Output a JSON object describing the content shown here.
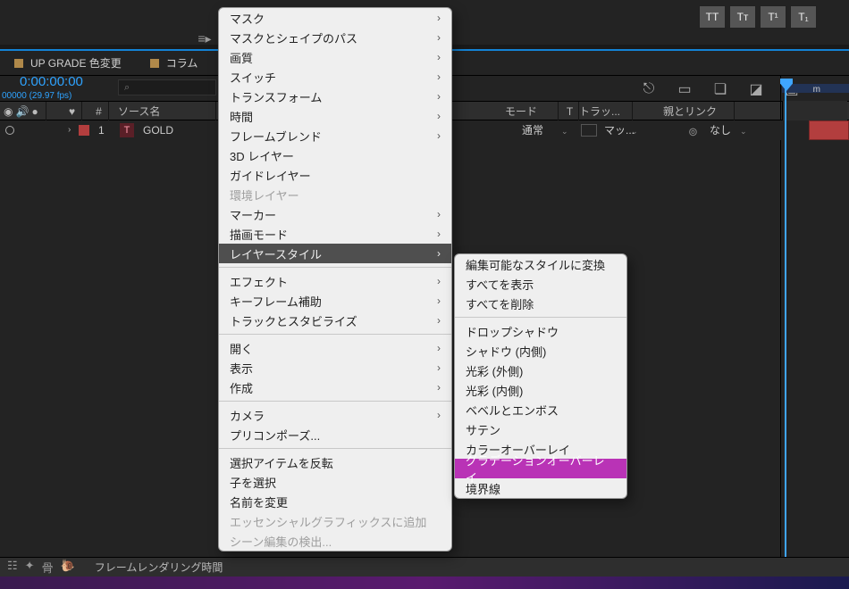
{
  "toolbar": {
    "text_styles": [
      "TT",
      "Tт",
      "T¹",
      "T₁"
    ]
  },
  "tabs": {
    "tab1": "UP GRADE 色変更",
    "tab2": "コラム"
  },
  "timecode": {
    "value": "0:00:00:00",
    "sub": "00000 (29.97 fps)"
  },
  "search": {
    "placeholder": "⌕"
  },
  "columns": {
    "tag": "♥",
    "num": "#",
    "source": "ソース名",
    "mode": "モード",
    "t": "T",
    "track": "トラッ...",
    "parent": "親とリンク"
  },
  "layer": {
    "index": "1",
    "type_badge": "T",
    "name": "GOLD",
    "mode": "通常",
    "track_matte": "マッ...",
    "parent": "なし"
  },
  "ruler_label": "m",
  "bottom": {
    "label": "フレームレンダリング時間"
  },
  "menu_main": [
    {
      "label": "マスク",
      "arrow": true
    },
    {
      "label": "マスクとシェイプのパス",
      "arrow": true
    },
    {
      "label": "画質",
      "arrow": true
    },
    {
      "label": "スイッチ",
      "arrow": true
    },
    {
      "label": "トランスフォーム",
      "arrow": true
    },
    {
      "label": "時間",
      "arrow": true
    },
    {
      "label": "フレームブレンド",
      "arrow": true
    },
    {
      "label": "3D レイヤー"
    },
    {
      "label": "ガイドレイヤー"
    },
    {
      "label": "環境レイヤー",
      "disabled": true
    },
    {
      "label": "マーカー",
      "arrow": true
    },
    {
      "label": "描画モード",
      "arrow": true
    },
    {
      "label": "レイヤースタイル",
      "arrow": true,
      "hi": true
    },
    {
      "sep": true
    },
    {
      "label": "エフェクト",
      "arrow": true
    },
    {
      "label": "キーフレーム補助",
      "arrow": true
    },
    {
      "label": "トラックとスタビライズ",
      "arrow": true
    },
    {
      "sep": true
    },
    {
      "label": "開く",
      "arrow": true
    },
    {
      "label": "表示",
      "arrow": true
    },
    {
      "label": "作成",
      "arrow": true
    },
    {
      "sep": true
    },
    {
      "label": "カメラ",
      "arrow": true
    },
    {
      "label": "プリコンポーズ..."
    },
    {
      "sep": true
    },
    {
      "label": "選択アイテムを反転"
    },
    {
      "label": "子を選択"
    },
    {
      "label": "名前を変更"
    },
    {
      "label": "エッセンシャルグラフィックスに追加",
      "disabled": true
    },
    {
      "label": "シーン編集の検出...",
      "disabled": true
    }
  ],
  "menu_sub": [
    {
      "label": "編集可能なスタイルに変換"
    },
    {
      "label": "すべてを表示"
    },
    {
      "label": "すべてを削除"
    },
    {
      "sep": true
    },
    {
      "label": "ドロップシャドウ"
    },
    {
      "label": "シャドウ (内側)"
    },
    {
      "label": "光彩 (外側)"
    },
    {
      "label": "光彩 (内側)"
    },
    {
      "label": "ベベルとエンボス"
    },
    {
      "label": "サテン"
    },
    {
      "label": "カラーオーバーレイ"
    },
    {
      "label": "グラデーションオーバーレイ",
      "sel": true
    },
    {
      "label": "境界線"
    }
  ]
}
